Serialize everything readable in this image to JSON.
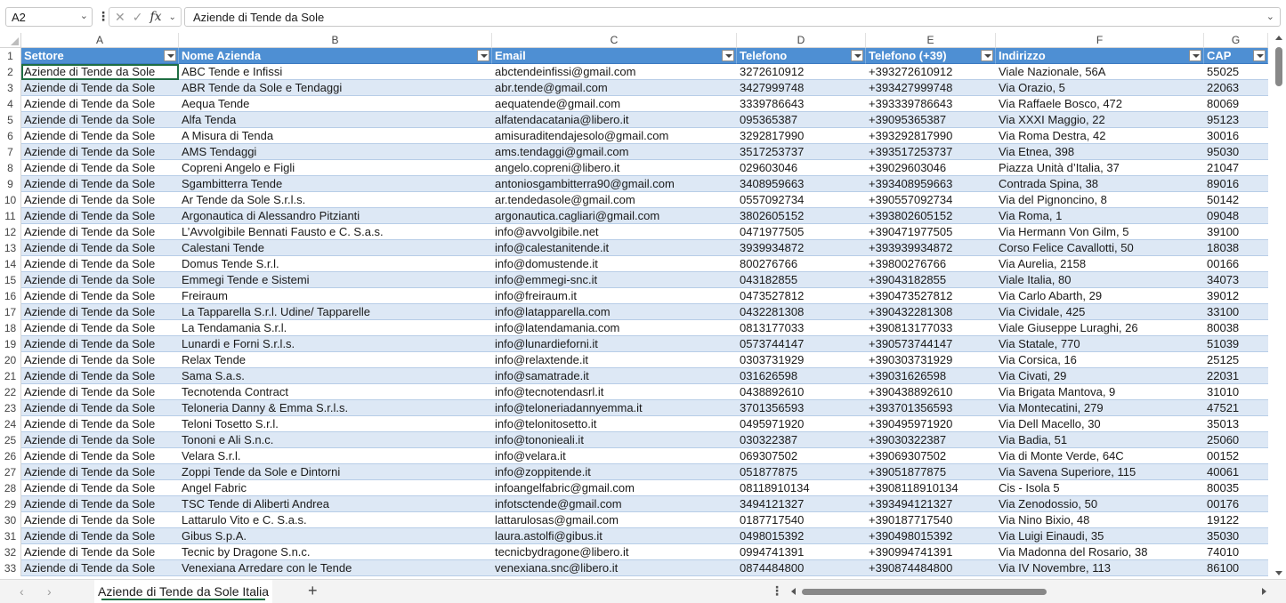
{
  "formula_bar": {
    "name_box": "A2",
    "formula": "Aziende di Tende da Sole"
  },
  "columns": [
    "A",
    "B",
    "C",
    "D",
    "E",
    "F",
    "G"
  ],
  "headers": [
    "Settore",
    "Nome Azienda",
    "Email",
    "Telefono",
    "Telefono (+39)",
    "Indirizzo",
    "CAP"
  ],
  "rows": [
    [
      "Aziende di Tende da Sole",
      "ABC Tende e Infissi",
      "abctendeinfissi@gmail.com",
      "3272610912",
      "+393272610912",
      "Viale Nazionale, 56A",
      "55025"
    ],
    [
      "Aziende di Tende da Sole",
      "ABR Tende da Sole e Tendaggi",
      "abr.tende@gmail.com",
      "3427999748",
      "+393427999748",
      "Via Orazio, 5",
      "22063"
    ],
    [
      "Aziende di Tende da Sole",
      "Aequa Tende",
      "aequatende@gmail.com",
      "3339786643",
      "+393339786643",
      "Via Raffaele Bosco, 472",
      "80069"
    ],
    [
      "Aziende di Tende da Sole",
      "Alfa Tenda",
      "alfatendacatania@libero.it",
      "095365387",
      "+39095365387",
      "Via XXXI Maggio, 22",
      "95123"
    ],
    [
      "Aziende di Tende da Sole",
      "A Misura di Tenda",
      "amisuraditendajesolo@gmail.com",
      "3292817990",
      "+393292817990",
      "Via Roma Destra, 42",
      "30016"
    ],
    [
      "Aziende di Tende da Sole",
      "AMS Tendaggi",
      "ams.tendaggi@gmail.com",
      "3517253737",
      "+393517253737",
      "Via Etnea, 398",
      "95030"
    ],
    [
      "Aziende di Tende da Sole",
      "Copreni Angelo e Figli",
      "angelo.copreni@libero.it",
      "029603046",
      "+39029603046",
      "Piazza Unità d’Italia, 37",
      "21047"
    ],
    [
      "Aziende di Tende da Sole",
      "Sgambitterra Tende",
      "antoniosgambitterra90@gmail.com",
      "3408959663",
      "+393408959663",
      "Contrada Spina, 38",
      "89016"
    ],
    [
      "Aziende di Tende da Sole",
      "Ar Tende da Sole S.r.l.s.",
      "ar.tendedasole@gmail.com",
      "0557092734",
      "+390557092734",
      "Via del Pignoncino, 8",
      "50142"
    ],
    [
      "Aziende di Tende da Sole",
      "Argonautica di Alessandro Pitzianti",
      "argonautica.cagliari@gmail.com",
      "3802605152",
      "+393802605152",
      "Via Roma, 1",
      "09048"
    ],
    [
      "Aziende di Tende da Sole",
      "L’Avvolgibile Bennati Fausto e C. S.a.s.",
      "info@avvolgibile.net",
      "0471977505",
      "+390471977505",
      "Via Hermann Von Gilm, 5",
      "39100"
    ],
    [
      "Aziende di Tende da Sole",
      "Calestani Tende",
      "info@calestanitende.it",
      "3939934872",
      "+393939934872",
      "Corso Felice Cavallotti, 50",
      "18038"
    ],
    [
      "Aziende di Tende da Sole",
      "Domus Tende S.r.l.",
      "info@domustende.it",
      "800276766",
      "+39800276766",
      "Via Aurelia, 2158",
      "00166"
    ],
    [
      "Aziende di Tende da Sole",
      "Emmegi Tende e Sistemi",
      "info@emmegi-snc.it",
      "043182855",
      "+39043182855",
      "Viale Italia, 80",
      "34073"
    ],
    [
      "Aziende di Tende da Sole",
      "Freiraum",
      "info@freiraum.it",
      "0473527812",
      "+390473527812",
      "Via Carlo Abarth, 29",
      "39012"
    ],
    [
      "Aziende di Tende da Sole",
      "La Tapparella S.r.l. Udine/ Tapparelle",
      "info@latapparella.com",
      "0432281308",
      "+390432281308",
      "Via Cividale, 425",
      "33100"
    ],
    [
      "Aziende di Tende da Sole",
      "La Tendamania S.r.l.",
      "info@latendamania.com",
      "0813177033",
      "+390813177033",
      "Viale Giuseppe Luraghi, 26",
      "80038"
    ],
    [
      "Aziende di Tende da Sole",
      "Lunardi e Forni S.r.l.s.",
      "info@lunardieforni.it",
      "0573744147",
      "+390573744147",
      "Via Statale, 770",
      "51039"
    ],
    [
      "Aziende di Tende da Sole",
      "Relax Tende",
      "info@relaxtende.it",
      "0303731929",
      "+390303731929",
      "Via Corsica, 16",
      "25125"
    ],
    [
      "Aziende di Tende da Sole",
      "Sama S.a.s.",
      "info@samatrade.it",
      "031626598",
      "+39031626598",
      "Via Civati, 29",
      "22031"
    ],
    [
      "Aziende di Tende da Sole",
      "Tecnotenda Contract",
      "info@tecnotendasrl.it",
      "0438892610",
      "+390438892610",
      "Via Brigata Mantova, 9",
      "31010"
    ],
    [
      "Aziende di Tende da Sole",
      "Teloneria Danny & Emma S.r.l.s.",
      "info@teloneriadannyemma.it",
      "3701356593",
      "+393701356593",
      "Via Montecatini, 279",
      "47521"
    ],
    [
      "Aziende di Tende da Sole",
      "Teloni Tosetto S.r.l.",
      "info@telonitosetto.it",
      "0495971920",
      "+390495971920",
      "Via Dell Macello, 30",
      "35013"
    ],
    [
      "Aziende di Tende da Sole",
      "Tononi e Ali S.n.c.",
      "info@tononieali.it",
      "030322387",
      "+39030322387",
      "Via Badia, 51",
      "25060"
    ],
    [
      "Aziende di Tende da Sole",
      "Velara S.r.l.",
      "info@velara.it",
      "069307502",
      "+39069307502",
      "Via di Monte Verde, 64C",
      "00152"
    ],
    [
      "Aziende di Tende da Sole",
      "Zoppi Tende da Sole e Dintorni",
      "info@zoppitende.it",
      "051877875",
      "+39051877875",
      "Via Savena Superiore, 115",
      "40061"
    ],
    [
      "Aziende di Tende da Sole",
      "Angel Fabric",
      "infoangelfabric@gmail.com",
      "08118910134",
      "+3908118910134",
      "Cis - Isola 5",
      "80035"
    ],
    [
      "Aziende di Tende da Sole",
      "TSC Tende di Aliberti Andrea",
      "infotsctende@gmail.com",
      "3494121327",
      "+393494121327",
      "Via Zenodossio, 50",
      "00176"
    ],
    [
      "Aziende di Tende da Sole",
      "Lattarulo Vito e C. S.a.s.",
      "lattarulosas@gmail.com",
      "0187717540",
      "+390187717540",
      "Via Nino Bixio, 48",
      "19122"
    ],
    [
      "Aziende di Tende da Sole",
      "Gibus S.p.A.",
      "laura.astolfi@gibus.it",
      "0498015392",
      "+390498015392",
      "Via Luigi Einaudi, 35",
      "35030"
    ],
    [
      "Aziende di Tende da Sole",
      "Tecnic by Dragone S.n.c.",
      "tecnicbydragone@libero.it",
      "0994741391",
      "+390994741391",
      "Via Madonna del Rosario, 38",
      "74010"
    ],
    [
      "Aziende di Tende da Sole",
      "Venexiana Arredare con le Tende",
      "venexiana.snc@libero.it",
      "0874484800",
      "+390874484800",
      "Via IV Novembre, 113",
      "86100"
    ]
  ],
  "sheet_tab": "Aziende di Tende da Sole Italia",
  "colors": {
    "header_bg": "#4e8fd3",
    "band_bg": "#dde8f5",
    "accent": "#1f6e43"
  }
}
